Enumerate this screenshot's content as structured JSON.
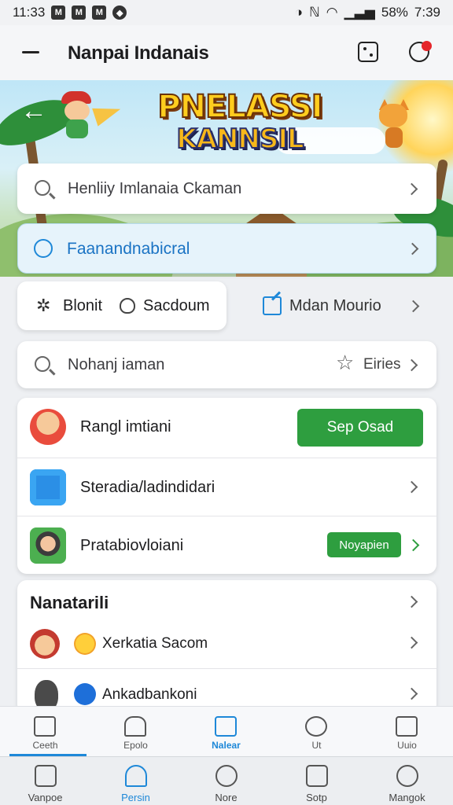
{
  "status_bar": {
    "time": "11:33",
    "battery": "58%",
    "clock_right": "7:39"
  },
  "header": {
    "title": "Nanpai Indanais"
  },
  "banner": {
    "logo_line1": "PNELASSI",
    "logo_line2": "KANNSIL"
  },
  "search_bar": {
    "text": "Henliiy Imlanaia Ckaman"
  },
  "feature_row": {
    "text": "Faanandnabicral"
  },
  "segment": {
    "item1": "Blonit",
    "item2": "Sacdoum",
    "edit_label": "Mdan Mourio"
  },
  "search_bar_2": {
    "text": "Nohanj iaman",
    "filter_label": "Eiries"
  },
  "list_1": [
    {
      "label": "Rangl imtiani",
      "button": "Sep Osad"
    },
    {
      "label": "Steradia/ladindidari"
    },
    {
      "label": "Pratabiovloiani",
      "button": "Noyapien"
    }
  ],
  "section": {
    "title": "Nanatarili",
    "rows": [
      {
        "label": "Xerkatia Sacom"
      },
      {
        "label": "Ankadbankoni"
      }
    ]
  },
  "tabs": [
    {
      "label": "Ceeth"
    },
    {
      "label": "Epolo"
    },
    {
      "label": "Nalear",
      "active": true
    },
    {
      "label": "Ut"
    },
    {
      "label": "Uuio"
    }
  ],
  "bottom_nav": [
    {
      "label": "Vanpoe"
    },
    {
      "label": "Persin",
      "active": true
    },
    {
      "label": "Nore"
    },
    {
      "label": "Sotp"
    },
    {
      "label": "Mangok"
    }
  ],
  "colors": {
    "accent": "#1e88d8",
    "green": "#2e9e3f",
    "badge_red": "#e5262b"
  }
}
